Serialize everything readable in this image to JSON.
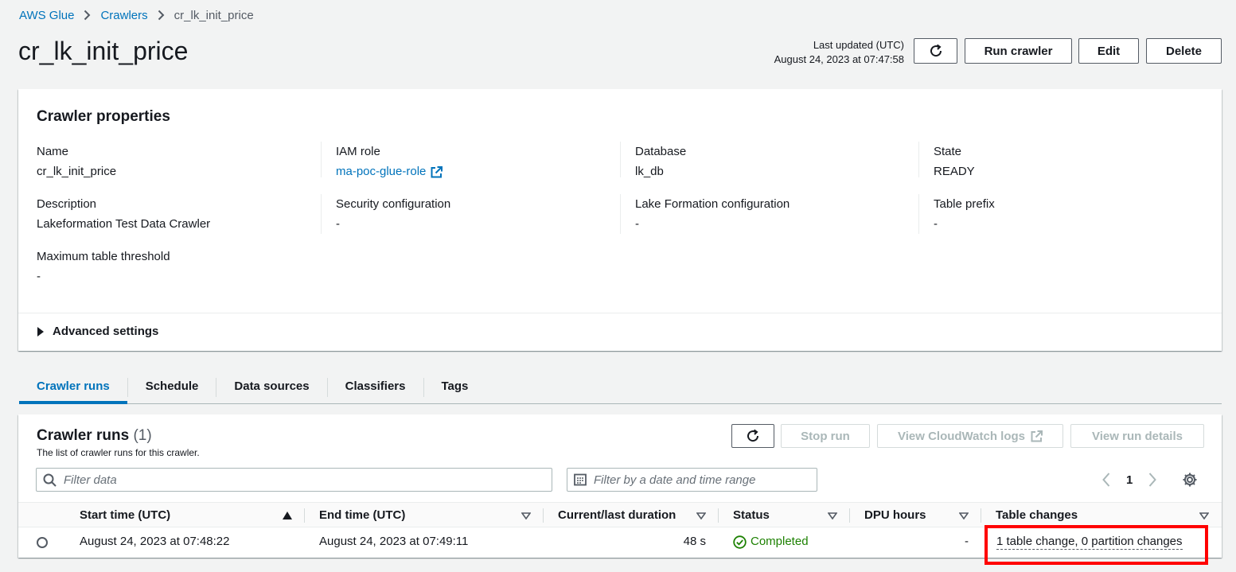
{
  "breadcrumb": {
    "root": "AWS Glue",
    "section": "Crawlers",
    "current": "cr_lk_init_price"
  },
  "header": {
    "title": "cr_lk_init_price",
    "last_updated_label": "Last updated (UTC)",
    "last_updated_value": "August 24, 2023 at 07:47:58",
    "run_label": "Run crawler",
    "edit_label": "Edit",
    "delete_label": "Delete",
    "refresh_icon": "refresh-icon"
  },
  "properties": {
    "title": "Crawler properties",
    "name_label": "Name",
    "name_value": "cr_lk_init_price",
    "iam_label": "IAM role",
    "iam_value": "ma-poc-glue-role",
    "database_label": "Database",
    "database_value": "lk_db",
    "state_label": "State",
    "state_value": "READY",
    "description_label": "Description",
    "description_value": "Lakeformation Test Data Crawler",
    "security_label": "Security configuration",
    "security_value": "-",
    "lakeformation_label": "Lake Formation configuration",
    "lakeformation_value": "-",
    "prefix_label": "Table prefix",
    "prefix_value": "-",
    "threshold_label": "Maximum table threshold",
    "threshold_value": "-",
    "advanced_label": "Advanced settings"
  },
  "tabs": [
    {
      "label": "Crawler runs",
      "active": true
    },
    {
      "label": "Schedule"
    },
    {
      "label": "Data sources"
    },
    {
      "label": "Classifiers"
    },
    {
      "label": "Tags"
    }
  ],
  "runs": {
    "title": "Crawler runs",
    "count": "(1)",
    "description": "The list of crawler runs for this crawler.",
    "stop_label": "Stop run",
    "cloudwatch_label": "View CloudWatch logs",
    "details_label": "View run details",
    "filter_placeholder": "Filter data",
    "date_placeholder": "Filter by a date and time range",
    "page": "1",
    "columns": [
      "Start time (UTC)",
      "End time (UTC)",
      "Current/last duration",
      "Status",
      "DPU hours",
      "Table changes"
    ],
    "rows": [
      {
        "start": "August 24, 2023 at 07:48:22",
        "end": "August 24, 2023 at 07:49:11",
        "duration": "48 s",
        "status": "Completed",
        "dpu": "-",
        "changes": "1 table change, 0 partition changes"
      }
    ]
  },
  "colors": {
    "link": "#0073bb",
    "success": "#1d8102",
    "highlight": "#ff0000"
  }
}
